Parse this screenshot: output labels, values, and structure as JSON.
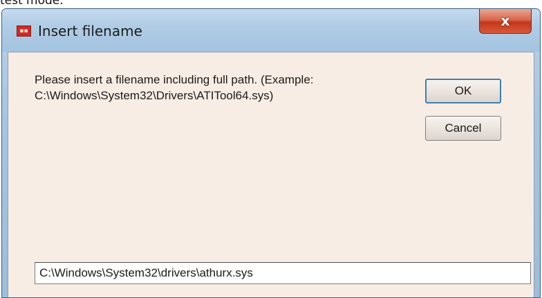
{
  "caption": "test mode.",
  "window": {
    "title": "Insert filename",
    "icon": "app-icon",
    "close_label": "x"
  },
  "dialog": {
    "message_line1": "Please insert a filename including full path. (Example:",
    "message_line2": "C:\\Windows\\System32\\Drivers\\ATITool64.sys)",
    "ok_label": "OK",
    "cancel_label": "Cancel",
    "path_value": "C:\\Windows\\System32\\drivers\\athurx.sys"
  },
  "colors": {
    "titlebar": "#b2cde6",
    "close_button": "#c3381c",
    "client_background": "#f8ede4",
    "default_button_border": "#3c7fb1"
  }
}
